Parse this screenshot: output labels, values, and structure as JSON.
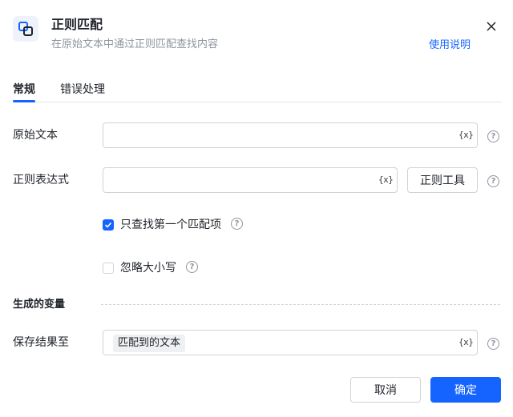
{
  "header": {
    "title": "正则匹配",
    "subtitle": "在原始文本中通过正则匹配查找内容",
    "help_link": "使用说明",
    "icon": "regex-match-icon",
    "close_icon": "close-icon"
  },
  "tabs": [
    {
      "label": "常规",
      "active": true
    },
    {
      "label": "错误处理",
      "active": false
    }
  ],
  "form": {
    "source_text": {
      "label": "原始文本",
      "value": "",
      "var_icon_text": "{x}"
    },
    "regex": {
      "label": "正则表达式",
      "value": "",
      "var_icon_text": "{x}",
      "tool_button": "正则工具"
    },
    "first_match_only": {
      "label": "只查找第一个匹配项",
      "checked": true
    },
    "ignore_case": {
      "label": "忽略大小写",
      "checked": false
    }
  },
  "output": {
    "section_title": "生成的变量",
    "save_to": {
      "label": "保存结果至",
      "tag": "匹配到的文本",
      "var_icon_text": "{x}"
    }
  },
  "help_icon_text": "?",
  "footer": {
    "cancel": "取消",
    "confirm": "确定"
  },
  "colors": {
    "primary": "#1664ff",
    "text": "#1f2329",
    "muted": "#8f959e",
    "border": "#d0d3d6"
  }
}
